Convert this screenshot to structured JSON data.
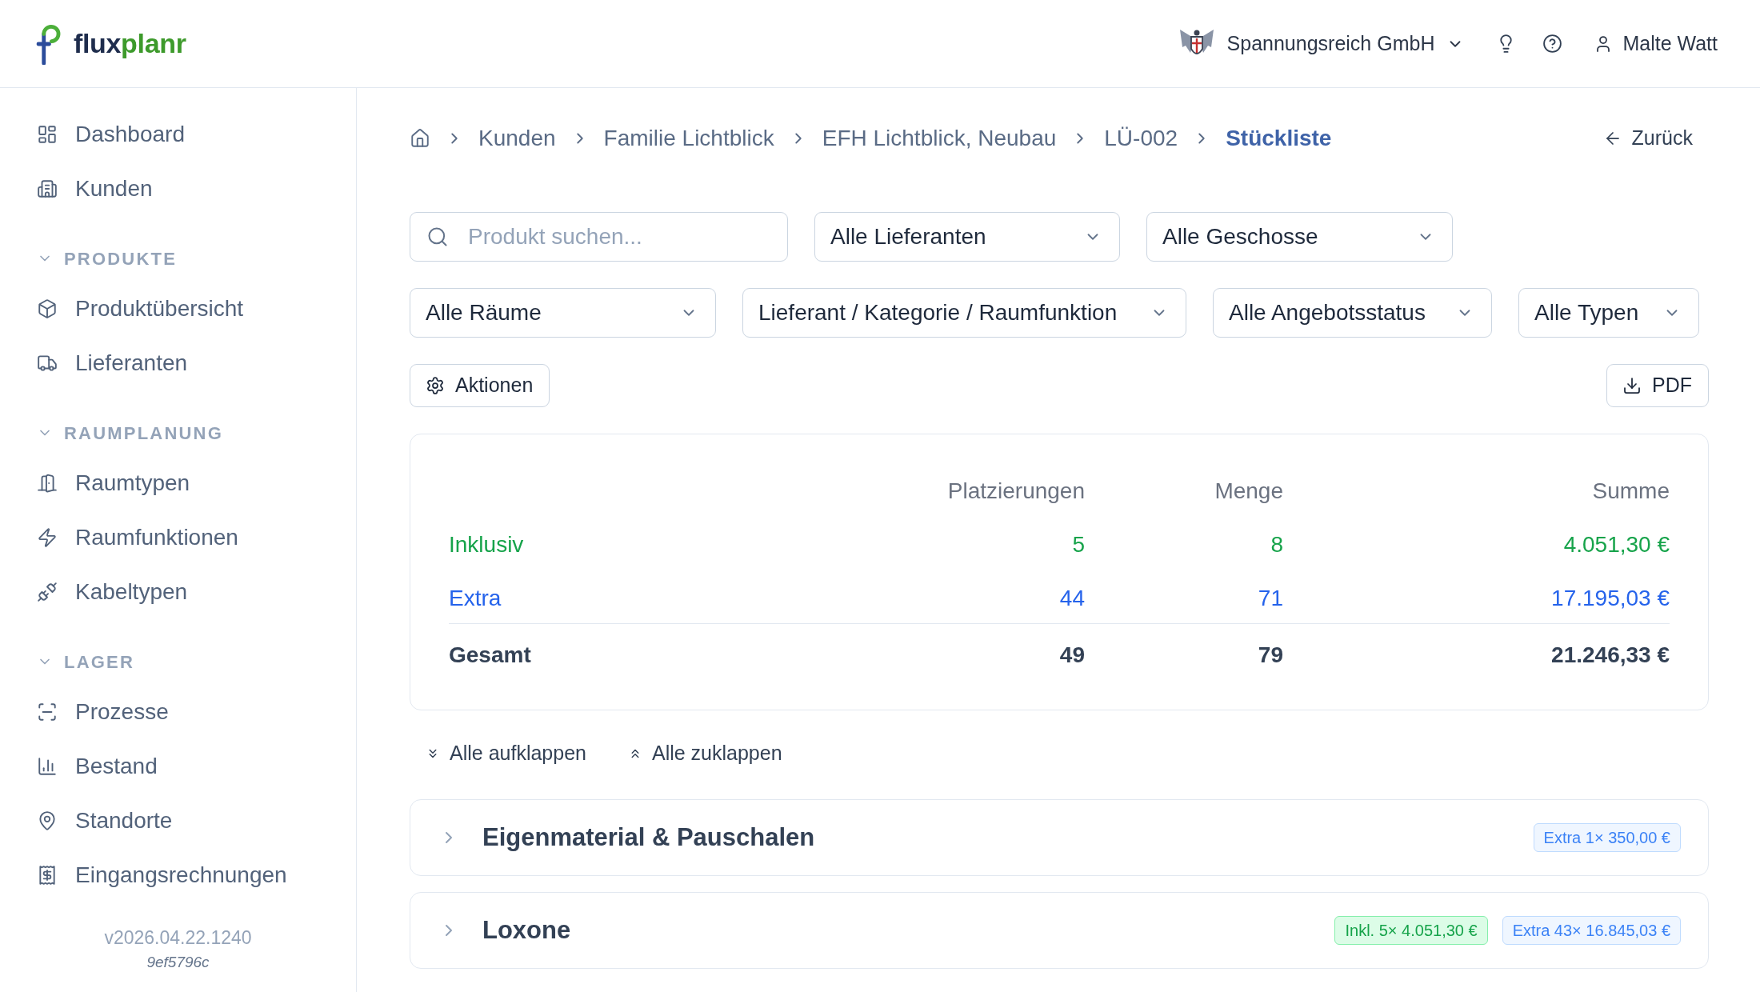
{
  "header": {
    "brand": {
      "parts": [
        "flux",
        "planr"
      ]
    },
    "company": {
      "name": "Spannungsreich GmbH"
    },
    "user": {
      "name": "Malte Watt"
    }
  },
  "sidebar": {
    "items": [
      {
        "label": "Dashboard",
        "selected": false
      },
      {
        "label": "Kunden",
        "selected": false
      }
    ],
    "sections": [
      {
        "title": "PRODUKTE",
        "expanded": true,
        "items": [
          {
            "label": "Produktübersicht",
            "selected": false
          },
          {
            "label": "Lieferanten",
            "selected": false
          }
        ]
      },
      {
        "title": "RAUMPLANUNG",
        "expanded": true,
        "items": [
          {
            "label": "Raumtypen",
            "selected": false
          },
          {
            "label": "Raumfunktionen",
            "selected": false
          },
          {
            "label": "Kabeltypen",
            "selected": false
          }
        ]
      },
      {
        "title": "LAGER",
        "expanded": true,
        "items": [
          {
            "label": "Prozesse",
            "selected": false
          },
          {
            "label": "Bestand",
            "selected": false
          },
          {
            "label": "Standorte",
            "selected": false
          },
          {
            "label": "Eingangsrechnungen",
            "selected": false
          }
        ]
      }
    ],
    "version": "v2026.04.22.1240",
    "build": "9ef5796c"
  },
  "breadcrumb": [
    {
      "label": "Kunden",
      "current": false
    },
    {
      "label": "Familie Lichtblick",
      "current": false
    },
    {
      "label": "EFH Lichtblick, Neubau",
      "current": false
    },
    {
      "label": "LÜ-002",
      "current": false
    },
    {
      "label": "Stückliste",
      "current": true
    }
  ],
  "back_link": "Zurück",
  "filters": {
    "rows": [
      {
        "fields": [
          {
            "kind": "search",
            "placeholder": "Produkt suchen..."
          },
          {
            "kind": "select",
            "value": "Alle Lieferanten"
          },
          {
            "kind": "select",
            "value": "Alle Geschosse"
          }
        ]
      },
      {
        "fields": [
          {
            "kind": "select",
            "value": "Alle Räume"
          },
          {
            "kind": "select",
            "value": "Lieferant / Kategorie / Raumfunktion"
          },
          {
            "kind": "select",
            "value": "Alle Angebotsstatus"
          },
          {
            "kind": "select",
            "value": "Alle Typen"
          }
        ]
      }
    ]
  },
  "toolbar": {
    "actions_button": "Aktionen",
    "pdf_button": "PDF"
  },
  "summary": {
    "columns": [
      "Platzierungen",
      "Menge",
      "Summe"
    ],
    "rows": [
      {
        "kind": "inclusive",
        "label": "Inklusiv",
        "placements": "5",
        "quantity": "8",
        "sum": "4.051,30 €"
      },
      {
        "kind": "extra",
        "label": "Extra",
        "placements": "44",
        "quantity": "71",
        "sum": "17.195,03 €"
      },
      {
        "kind": "total",
        "label": "Gesamt",
        "placements": "49",
        "quantity": "79",
        "sum": "21.246,33 €"
      }
    ]
  },
  "expand_controls": [
    {
      "kind": "expand",
      "label": "Alle aufklappen"
    },
    {
      "kind": "collapse",
      "label": "Alle zuklappen"
    }
  ],
  "groups": [
    {
      "title": "Eigenmaterial & Pauschalen",
      "expanded": false,
      "badges": [
        {
          "kind": "extra",
          "text": "Extra 1× 350,00 €"
        }
      ]
    },
    {
      "title": "Loxone",
      "expanded": false,
      "badges": [
        {
          "kind": "inclusive",
          "text": "Inkl. 5× 4.051,30 €"
        },
        {
          "kind": "extra",
          "text": "Extra 43× 16.845,03 €"
        }
      ]
    }
  ]
}
